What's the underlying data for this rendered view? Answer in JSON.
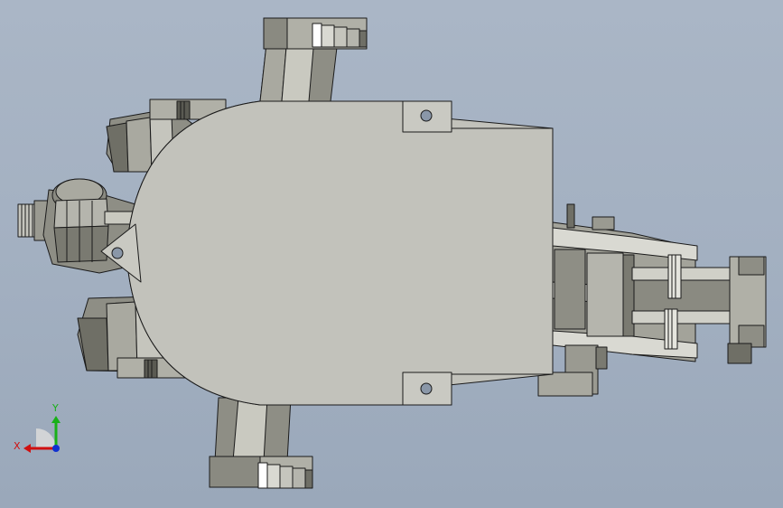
{
  "viewport": {
    "background_top": "#aab6c6",
    "background_bottom": "#9aa8ba"
  },
  "model": {
    "icon": "cad-robot-chassis-top-view",
    "body_color": "#c2c2bb",
    "outline_color": "#1a1a1a",
    "part_light": "#d9d9d2",
    "part_mid": "#a9a9a0",
    "part_dark": "#6f6f66"
  },
  "triad": {
    "x_label": "X",
    "y_label": "Y",
    "x_color": "#d01010",
    "y_color": "#18b018",
    "z_color": "#1030d0"
  }
}
